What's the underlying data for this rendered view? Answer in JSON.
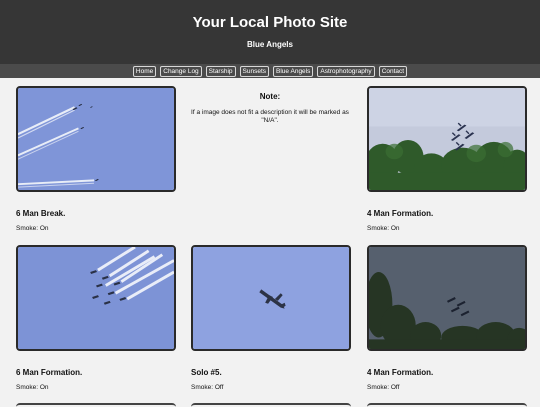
{
  "site": {
    "title": "Your Local Photo Site",
    "subtitle": "Blue Angels"
  },
  "nav": [
    {
      "label": "Home"
    },
    {
      "label": "Change Log"
    },
    {
      "label": "Starship"
    },
    {
      "label": "Sunsets"
    },
    {
      "label": "Blue Angels"
    },
    {
      "label": "Astrophotography"
    },
    {
      "label": "Contact"
    }
  ],
  "note": {
    "title": "Note:",
    "text": "If a image does not fit a description it will be marked as \"N/A\"."
  },
  "photos": [
    {
      "title": "6 Man Break.",
      "smoke": "Smoke: On"
    },
    {
      "title": "4 Man Formation.",
      "smoke": "Smoke: On"
    },
    {
      "title": "6 Man Formation.",
      "smoke": "Smoke: On"
    },
    {
      "title": "Solo #5.",
      "smoke": "Smoke: Off"
    },
    {
      "title": "4 Man Formation.",
      "smoke": "Smoke: Off"
    }
  ],
  "colors": {
    "header": "#363636",
    "nav": "#4b4b4b",
    "background": "#f2f2f2",
    "sky": "#7f95d8"
  }
}
